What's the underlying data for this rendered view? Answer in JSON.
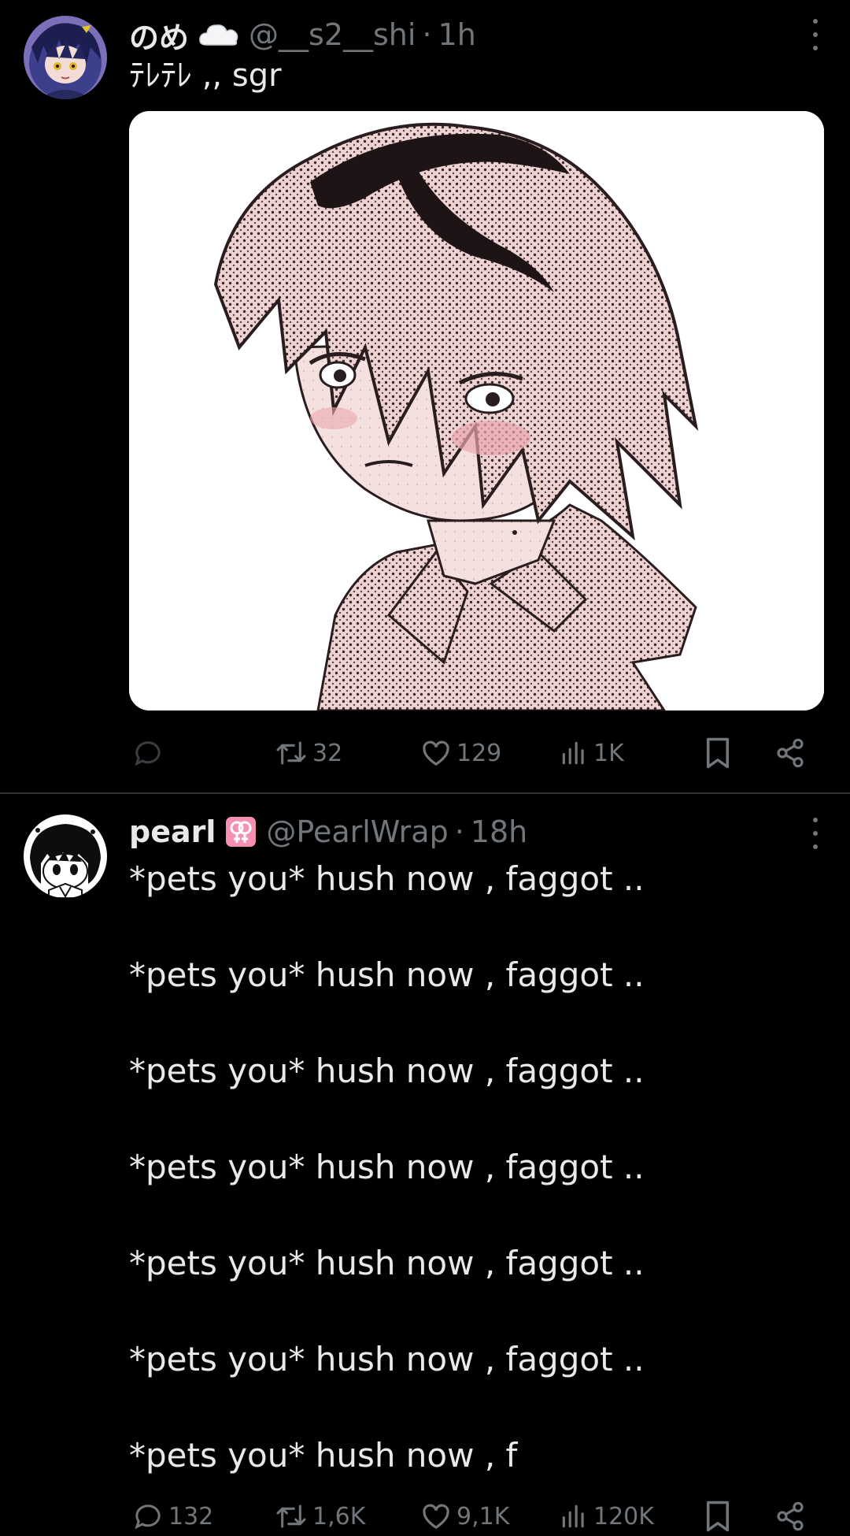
{
  "tweets": [
    {
      "name": "のめ",
      "name_emoji": "cloud-emoji",
      "handle": "@__s2__shi",
      "separator": "·",
      "time": "1h",
      "text": "ﾃﾚﾃﾚ ,, sgr",
      "media": "anime-sketch-image",
      "stats": {
        "replies": "",
        "reposts": "32",
        "likes": "129",
        "views": "1K"
      }
    },
    {
      "name": "pearl",
      "name_emoji": "lesbian-symbol-emoji",
      "handle": "@PearlWrap",
      "separator": "·",
      "time": "18h",
      "lines": [
        "*pets you* hush now , faggot ..",
        "*pets you* hush now , faggot ..",
        "*pets you* hush now , faggot ..",
        "*pets you* hush now , faggot ..",
        "*pets you* hush now , faggot ..",
        "*pets you* hush now , faggot ..",
        "*pets you* hush now , f"
      ],
      "stats": {
        "replies": "132",
        "reposts": "1,6K",
        "likes": "9,1K",
        "views": "120K"
      }
    }
  ],
  "colors": {
    "background": "#000000",
    "text": "#e7e9ea",
    "secondary": "#71767b",
    "divider": "#2f3336",
    "emoji_badge": "#f78fb3"
  }
}
